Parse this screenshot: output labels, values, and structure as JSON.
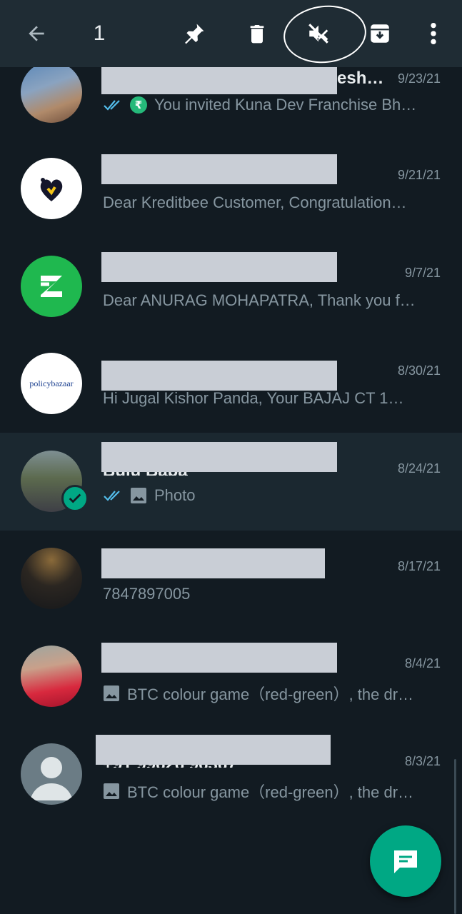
{
  "toolbar": {
    "selected_count": "1",
    "actions": [
      "back-icon",
      "pin-icon",
      "delete-icon",
      "mute-icon",
      "archive-icon",
      "more-icon"
    ]
  },
  "chats": [
    {
      "name_peek": "esh…",
      "date": "9/23/21",
      "preview": "You invited Kuna Dev Franchise Bh…",
      "status": "read",
      "icon": "rupee-icon"
    },
    {
      "date": "9/21/21",
      "preview": "Dear Kreditbee Customer, Congratulation…"
    },
    {
      "date": "9/7/21",
      "preview": "Dear ANURAG MOHAPATRA,  Thank you f…"
    },
    {
      "date": "8/30/21",
      "avatar_text": "policybazaar",
      "preview": "Hi Jugal Kishor Panda,  Your BAJAJ CT 1…"
    },
    {
      "name_peek": "Bulu Baba",
      "date": "8/24/21",
      "preview": "Photo",
      "status": "read",
      "icon": "image-icon",
      "selected": true
    },
    {
      "date": "8/17/21",
      "preview": "7847897005"
    },
    {
      "date": "8/4/21",
      "preview": "BTC  colour game（red-green）, the dr…",
      "icon": "image-icon"
    },
    {
      "name_peek": "+91 99626 96367",
      "date": "8/3/21",
      "preview": "BTC  colour game（red-green）, the dr…",
      "icon": "image-icon"
    }
  ],
  "colors": {
    "background": "#121b22",
    "toolbar": "#1f2c34",
    "accent": "#00a884",
    "read_ticks": "#53bdeb",
    "secondary_text": "#8696a0"
  }
}
